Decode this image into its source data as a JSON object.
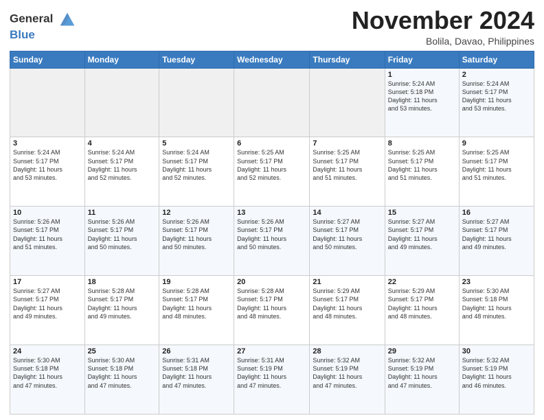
{
  "header": {
    "logo_line1": "General",
    "logo_line2": "Blue",
    "month_title": "November 2024",
    "subtitle": "Bolila, Davao, Philippines"
  },
  "days_of_week": [
    "Sunday",
    "Monday",
    "Tuesday",
    "Wednesday",
    "Thursday",
    "Friday",
    "Saturday"
  ],
  "weeks": [
    [
      {
        "day": "",
        "info": ""
      },
      {
        "day": "",
        "info": ""
      },
      {
        "day": "",
        "info": ""
      },
      {
        "day": "",
        "info": ""
      },
      {
        "day": "",
        "info": ""
      },
      {
        "day": "1",
        "info": "Sunrise: 5:24 AM\nSunset: 5:18 PM\nDaylight: 11 hours\nand 53 minutes."
      },
      {
        "day": "2",
        "info": "Sunrise: 5:24 AM\nSunset: 5:17 PM\nDaylight: 11 hours\nand 53 minutes."
      }
    ],
    [
      {
        "day": "3",
        "info": "Sunrise: 5:24 AM\nSunset: 5:17 PM\nDaylight: 11 hours\nand 53 minutes."
      },
      {
        "day": "4",
        "info": "Sunrise: 5:24 AM\nSunset: 5:17 PM\nDaylight: 11 hours\nand 52 minutes."
      },
      {
        "day": "5",
        "info": "Sunrise: 5:24 AM\nSunset: 5:17 PM\nDaylight: 11 hours\nand 52 minutes."
      },
      {
        "day": "6",
        "info": "Sunrise: 5:25 AM\nSunset: 5:17 PM\nDaylight: 11 hours\nand 52 minutes."
      },
      {
        "day": "7",
        "info": "Sunrise: 5:25 AM\nSunset: 5:17 PM\nDaylight: 11 hours\nand 51 minutes."
      },
      {
        "day": "8",
        "info": "Sunrise: 5:25 AM\nSunset: 5:17 PM\nDaylight: 11 hours\nand 51 minutes."
      },
      {
        "day": "9",
        "info": "Sunrise: 5:25 AM\nSunset: 5:17 PM\nDaylight: 11 hours\nand 51 minutes."
      }
    ],
    [
      {
        "day": "10",
        "info": "Sunrise: 5:26 AM\nSunset: 5:17 PM\nDaylight: 11 hours\nand 51 minutes."
      },
      {
        "day": "11",
        "info": "Sunrise: 5:26 AM\nSunset: 5:17 PM\nDaylight: 11 hours\nand 50 minutes."
      },
      {
        "day": "12",
        "info": "Sunrise: 5:26 AM\nSunset: 5:17 PM\nDaylight: 11 hours\nand 50 minutes."
      },
      {
        "day": "13",
        "info": "Sunrise: 5:26 AM\nSunset: 5:17 PM\nDaylight: 11 hours\nand 50 minutes."
      },
      {
        "day": "14",
        "info": "Sunrise: 5:27 AM\nSunset: 5:17 PM\nDaylight: 11 hours\nand 50 minutes."
      },
      {
        "day": "15",
        "info": "Sunrise: 5:27 AM\nSunset: 5:17 PM\nDaylight: 11 hours\nand 49 minutes."
      },
      {
        "day": "16",
        "info": "Sunrise: 5:27 AM\nSunset: 5:17 PM\nDaylight: 11 hours\nand 49 minutes."
      }
    ],
    [
      {
        "day": "17",
        "info": "Sunrise: 5:27 AM\nSunset: 5:17 PM\nDaylight: 11 hours\nand 49 minutes."
      },
      {
        "day": "18",
        "info": "Sunrise: 5:28 AM\nSunset: 5:17 PM\nDaylight: 11 hours\nand 49 minutes."
      },
      {
        "day": "19",
        "info": "Sunrise: 5:28 AM\nSunset: 5:17 PM\nDaylight: 11 hours\nand 48 minutes."
      },
      {
        "day": "20",
        "info": "Sunrise: 5:28 AM\nSunset: 5:17 PM\nDaylight: 11 hours\nand 48 minutes."
      },
      {
        "day": "21",
        "info": "Sunrise: 5:29 AM\nSunset: 5:17 PM\nDaylight: 11 hours\nand 48 minutes."
      },
      {
        "day": "22",
        "info": "Sunrise: 5:29 AM\nSunset: 5:17 PM\nDaylight: 11 hours\nand 48 minutes."
      },
      {
        "day": "23",
        "info": "Sunrise: 5:30 AM\nSunset: 5:18 PM\nDaylight: 11 hours\nand 48 minutes."
      }
    ],
    [
      {
        "day": "24",
        "info": "Sunrise: 5:30 AM\nSunset: 5:18 PM\nDaylight: 11 hours\nand 47 minutes."
      },
      {
        "day": "25",
        "info": "Sunrise: 5:30 AM\nSunset: 5:18 PM\nDaylight: 11 hours\nand 47 minutes."
      },
      {
        "day": "26",
        "info": "Sunrise: 5:31 AM\nSunset: 5:18 PM\nDaylight: 11 hours\nand 47 minutes."
      },
      {
        "day": "27",
        "info": "Sunrise: 5:31 AM\nSunset: 5:19 PM\nDaylight: 11 hours\nand 47 minutes."
      },
      {
        "day": "28",
        "info": "Sunrise: 5:32 AM\nSunset: 5:19 PM\nDaylight: 11 hours\nand 47 minutes."
      },
      {
        "day": "29",
        "info": "Sunrise: 5:32 AM\nSunset: 5:19 PM\nDaylight: 11 hours\nand 47 minutes."
      },
      {
        "day": "30",
        "info": "Sunrise: 5:32 AM\nSunset: 5:19 PM\nDaylight: 11 hours\nand 46 minutes."
      }
    ]
  ]
}
